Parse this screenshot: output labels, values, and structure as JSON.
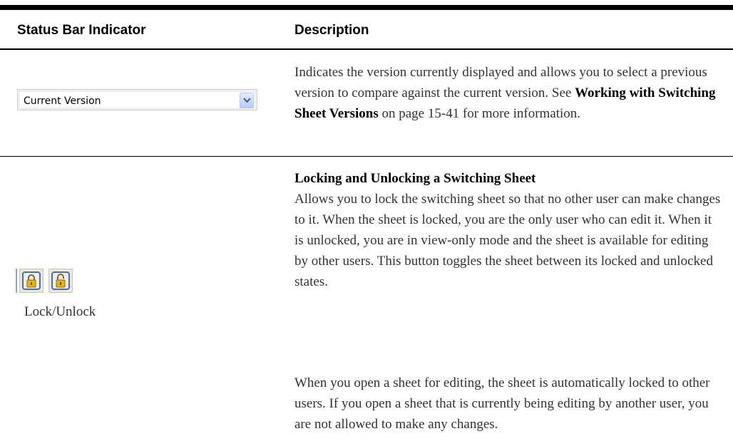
{
  "table": {
    "headers": {
      "indicator": "Status Bar Indicator",
      "description": "Description"
    },
    "rows": [
      {
        "indicator": {
          "widget": "dropdown",
          "value": "Current Version",
          "icon": "chevron-down-icon"
        },
        "description": {
          "text_before": "Indicates the version currently displayed and allows you to select a previous version to compare against the current version. See ",
          "link": "Working with Switching Sheet Versions",
          "text_after": " on page 15-41 for more information."
        }
      },
      {
        "indicator": {
          "icons": [
            "lock-icon",
            "unlock-icon"
          ],
          "label": "Lock/Unlock"
        },
        "description": {
          "heading": "Locking and Unlocking a Switching Sheet",
          "para1": "Allows you to lock the switching sheet so that no other user can make changes to it. When the sheet is locked, you are the only user who can edit it. When it is unlocked, you are in view-only mode and the sheet is available for editing by other users. This button toggles the sheet between its locked and unlocked states.",
          "para2": "When you open a sheet for editing, the sheet is automatically locked to other users. If you open a sheet that is currently being editing by another user, you are not allowed to make any changes."
        }
      }
    ]
  },
  "colors": {
    "rule": "#000000",
    "body_text": "#333333",
    "lock_icon": "#f2b200"
  }
}
